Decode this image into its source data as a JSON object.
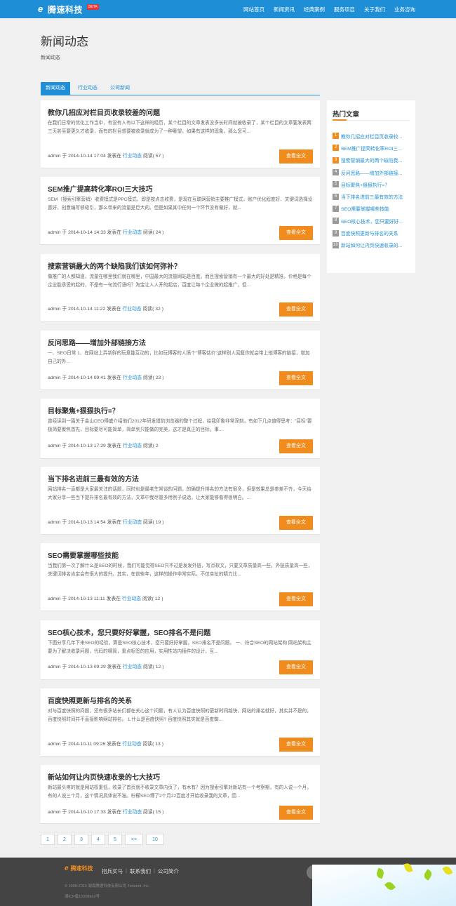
{
  "brand": {
    "logo_mark": "e",
    "name": "腾速科技",
    "badge": "BETA"
  },
  "nav": [
    "网站首页",
    "新闻资讯",
    "经典案例",
    "服务项目",
    "关于我们",
    "业务咨询"
  ],
  "page": {
    "title": "新闻动态",
    "breadcrumb": "新闻动态"
  },
  "tabs": [
    "新闻动态",
    "行业动态",
    "公司新闻"
  ],
  "articles": [
    {
      "title": "教你几招应对栏目页收录较差的问题",
      "excerpt": "在我们日常的优化工作当中，有没有人有以下这样的经历，某个栏目的文章发表没多长时间就被收录了，某个栏目的文章要发表两三天甚至要更久才收录，而有的栏目想要被收录就成为了一种奢望。如果有这样的现象，那么您可...",
      "meta_prefix": "admin 于 2014-10-14 17:04 发表在",
      "category": "行业动态",
      "reads": "阅读( 57 )",
      "button": "查看全文"
    },
    {
      "title": "SEM推广提高转化率ROI三大技巧",
      "excerpt": "SEM（搜索引擎营销）收费模式是PPC模式，即是按点击收费，是现在互联网营销主要推广模式，账户优化程度好、关键词选择设置好、创意编写够吸引，那么带来的流量是巨大的。但是如果其中任何一个环节没有做好，就...",
      "meta_prefix": "admin 于 2014-10-14 14:33 发表在",
      "category": "行业动态",
      "reads": "阅读( 24 )",
      "button": "查看全文"
    },
    {
      "title": "搜索营销最大的两个缺陷我们该如何弥补？",
      "excerpt": "做推广的人都知道，流量在哪里我们就在哪里，中国最大的流量网站是百度。而且搜索营销有一个最大的好处是精准，价格是每个企业能承受的起的，不是有一句流行语吗？淘宝让人人开的起店，百度让每个企业做的起推广，但...",
      "meta_prefix": "admin 于 2014-10-14 11:22 发表在",
      "category": "行业动态",
      "reads": "阅读( 32 )",
      "button": "查看全文"
    },
    {
      "title": "反问思路——增加外部链接方法",
      "excerpt": "一、SEO日常 1、在网站上弄新鲜的玩意能互动的，比如玩博客的人搞个\"博客估价\"这样别人回复你就会带上他博客的链接，增加自己的外...",
      "meta_prefix": "admin 于 2014-10-14 09:41 发表在",
      "category": "行业动态",
      "reads": "阅读( 23 )",
      "button": "查看全文"
    },
    {
      "title": "目标聚焦+狠狠执行=？",
      "excerpt": "曾经读到一篇关于金山CEO傅盛介绍他们2012年研发猎豹浏览器的整个过程，给我印象非常深刻，有如下几点值得思考：\"目标\"要极简要聚焦首先，目标要尽可能简单，简单到只能做的完美，这才是真正的目标。事...",
      "meta_prefix": "admin 于 2014-10-13 17:29 发表在",
      "category": "行业动态",
      "reads": "阅读( 2",
      "button": "查看全文"
    },
    {
      "title": "当下排名进前三最有效的方法",
      "excerpt": "网站排名一直都是大家最关注的话题，同时也是最老生常谈的问题，的确提升排名的方法有很多，但是效果总是参差不齐，今天给大家分享一些当下提升排名最有效的方法，文章中我尽量多用例子说话，让大家能够看得很明白。...",
      "meta_prefix": "admin 于 2014-10-13 14:54 发表在",
      "category": "行业动态",
      "reads": "阅读( 19 )",
      "button": "查看全文"
    },
    {
      "title": "SEO需要掌握哪些技能",
      "excerpt": "当我们第一次了解什么是SEO的时候，我们可能觉得SEO只不过是发发外链，写点软文，只要文章质量高一些，外链质量高一些，关键词排名肯定会有很大的提升。其实，在前些年，这样的操作非常实际，不仅幸扯的精力比...",
      "meta_prefix": "admin 于 2014-10-13 11:11 发表在",
      "category": "行业动态",
      "reads": "阅读( 12 )",
      "button": "查看全文"
    },
    {
      "title": "SEO核心技术，您只要好好掌握，SEO排名不是问题",
      "excerpt": "下面分享几年下来SEO的经验，算是SEO核心技术，您只要好好掌握，SEO排名不是问题。 一、符合SEO的网站架构 网站架构主要为了解决收录问题，代码的精简，重点标签的应用，实用性站内插件的设计，互...",
      "meta_prefix": "admin 于 2014-10-13 09:29 发表在",
      "category": "行业动态",
      "reads": "阅读( 12 )",
      "button": "查看全文"
    },
    {
      "title": "百度快照更新与排名的关系",
      "excerpt": "对与百度快照的问题，还有很多站长们都在关心这个问题，有人认为百度快照的更新时间越快，网站的排名就好，其实并不是的，百度快照时间并不直接影响网站排名。 1.什么是百度快照? 百度快照其实就是百度蜘...",
      "meta_prefix": "admin 于 2014-10-11 09:26 发表在",
      "category": "行业动态",
      "reads": "阅读( 13 )",
      "button": "查看全文"
    },
    {
      "title": "新站如何让内页快速收录的七大技巧",
      "excerpt": "新站最头疼的就是网站权重低，收录了首页就不收录文章内页了，有木有？因为搜索引擎对新站有一个考察期，有的人说一个月，有的人说三个月，这个情况具体说不准。柠檬SEO博了2个月22百度才开始收录我的文章，因...",
      "meta_prefix": "admin 于 2014-10-10 17:33 发表在",
      "category": "行业动态",
      "reads": "阅读( 15 )",
      "button": "查看全文"
    }
  ],
  "sidebar": {
    "title": "热门文章",
    "items": [
      {
        "num": "1",
        "label": "教你几招应对栏目页收录较..."
      },
      {
        "num": "2",
        "label": "SEM推广提高转化率ROI三..."
      },
      {
        "num": "3",
        "label": "搜索营销最大的两个缺陷我..."
      },
      {
        "num": "4",
        "label": "反问思路——增加外部链接..."
      },
      {
        "num": "5",
        "label": "目标聚焦+狠狠执行=？"
      },
      {
        "num": "6",
        "label": "当下排名进前三最有效的方法"
      },
      {
        "num": "7",
        "label": "SEO需要掌握哪些技能"
      },
      {
        "num": "8",
        "label": "SEO核心技术，您只要好好..."
      },
      {
        "num": "9",
        "label": "百度快照更新与排名的关系"
      },
      {
        "num": "10",
        "label": "新站如何让内页快速收录的..."
      }
    ]
  },
  "pagination": [
    "1",
    "2",
    "3",
    "4",
    "5",
    ">>",
    "10"
  ],
  "footer": {
    "logo_mark": "e",
    "logo_text": "腾速科技",
    "links": [
      "招兵买马",
      "联系我们",
      "公司简介"
    ],
    "separator": "|",
    "copyright": "© 2008-2015 湖南腾速科技有限公司 Tensent. Inc.",
    "icp": "湘ICP备12008622号"
  },
  "colors": {
    "primary": "#1e8fd6",
    "accent": "#f08c1e",
    "footer_bg": "#444444",
    "page_bg": "#f0f0f0"
  }
}
